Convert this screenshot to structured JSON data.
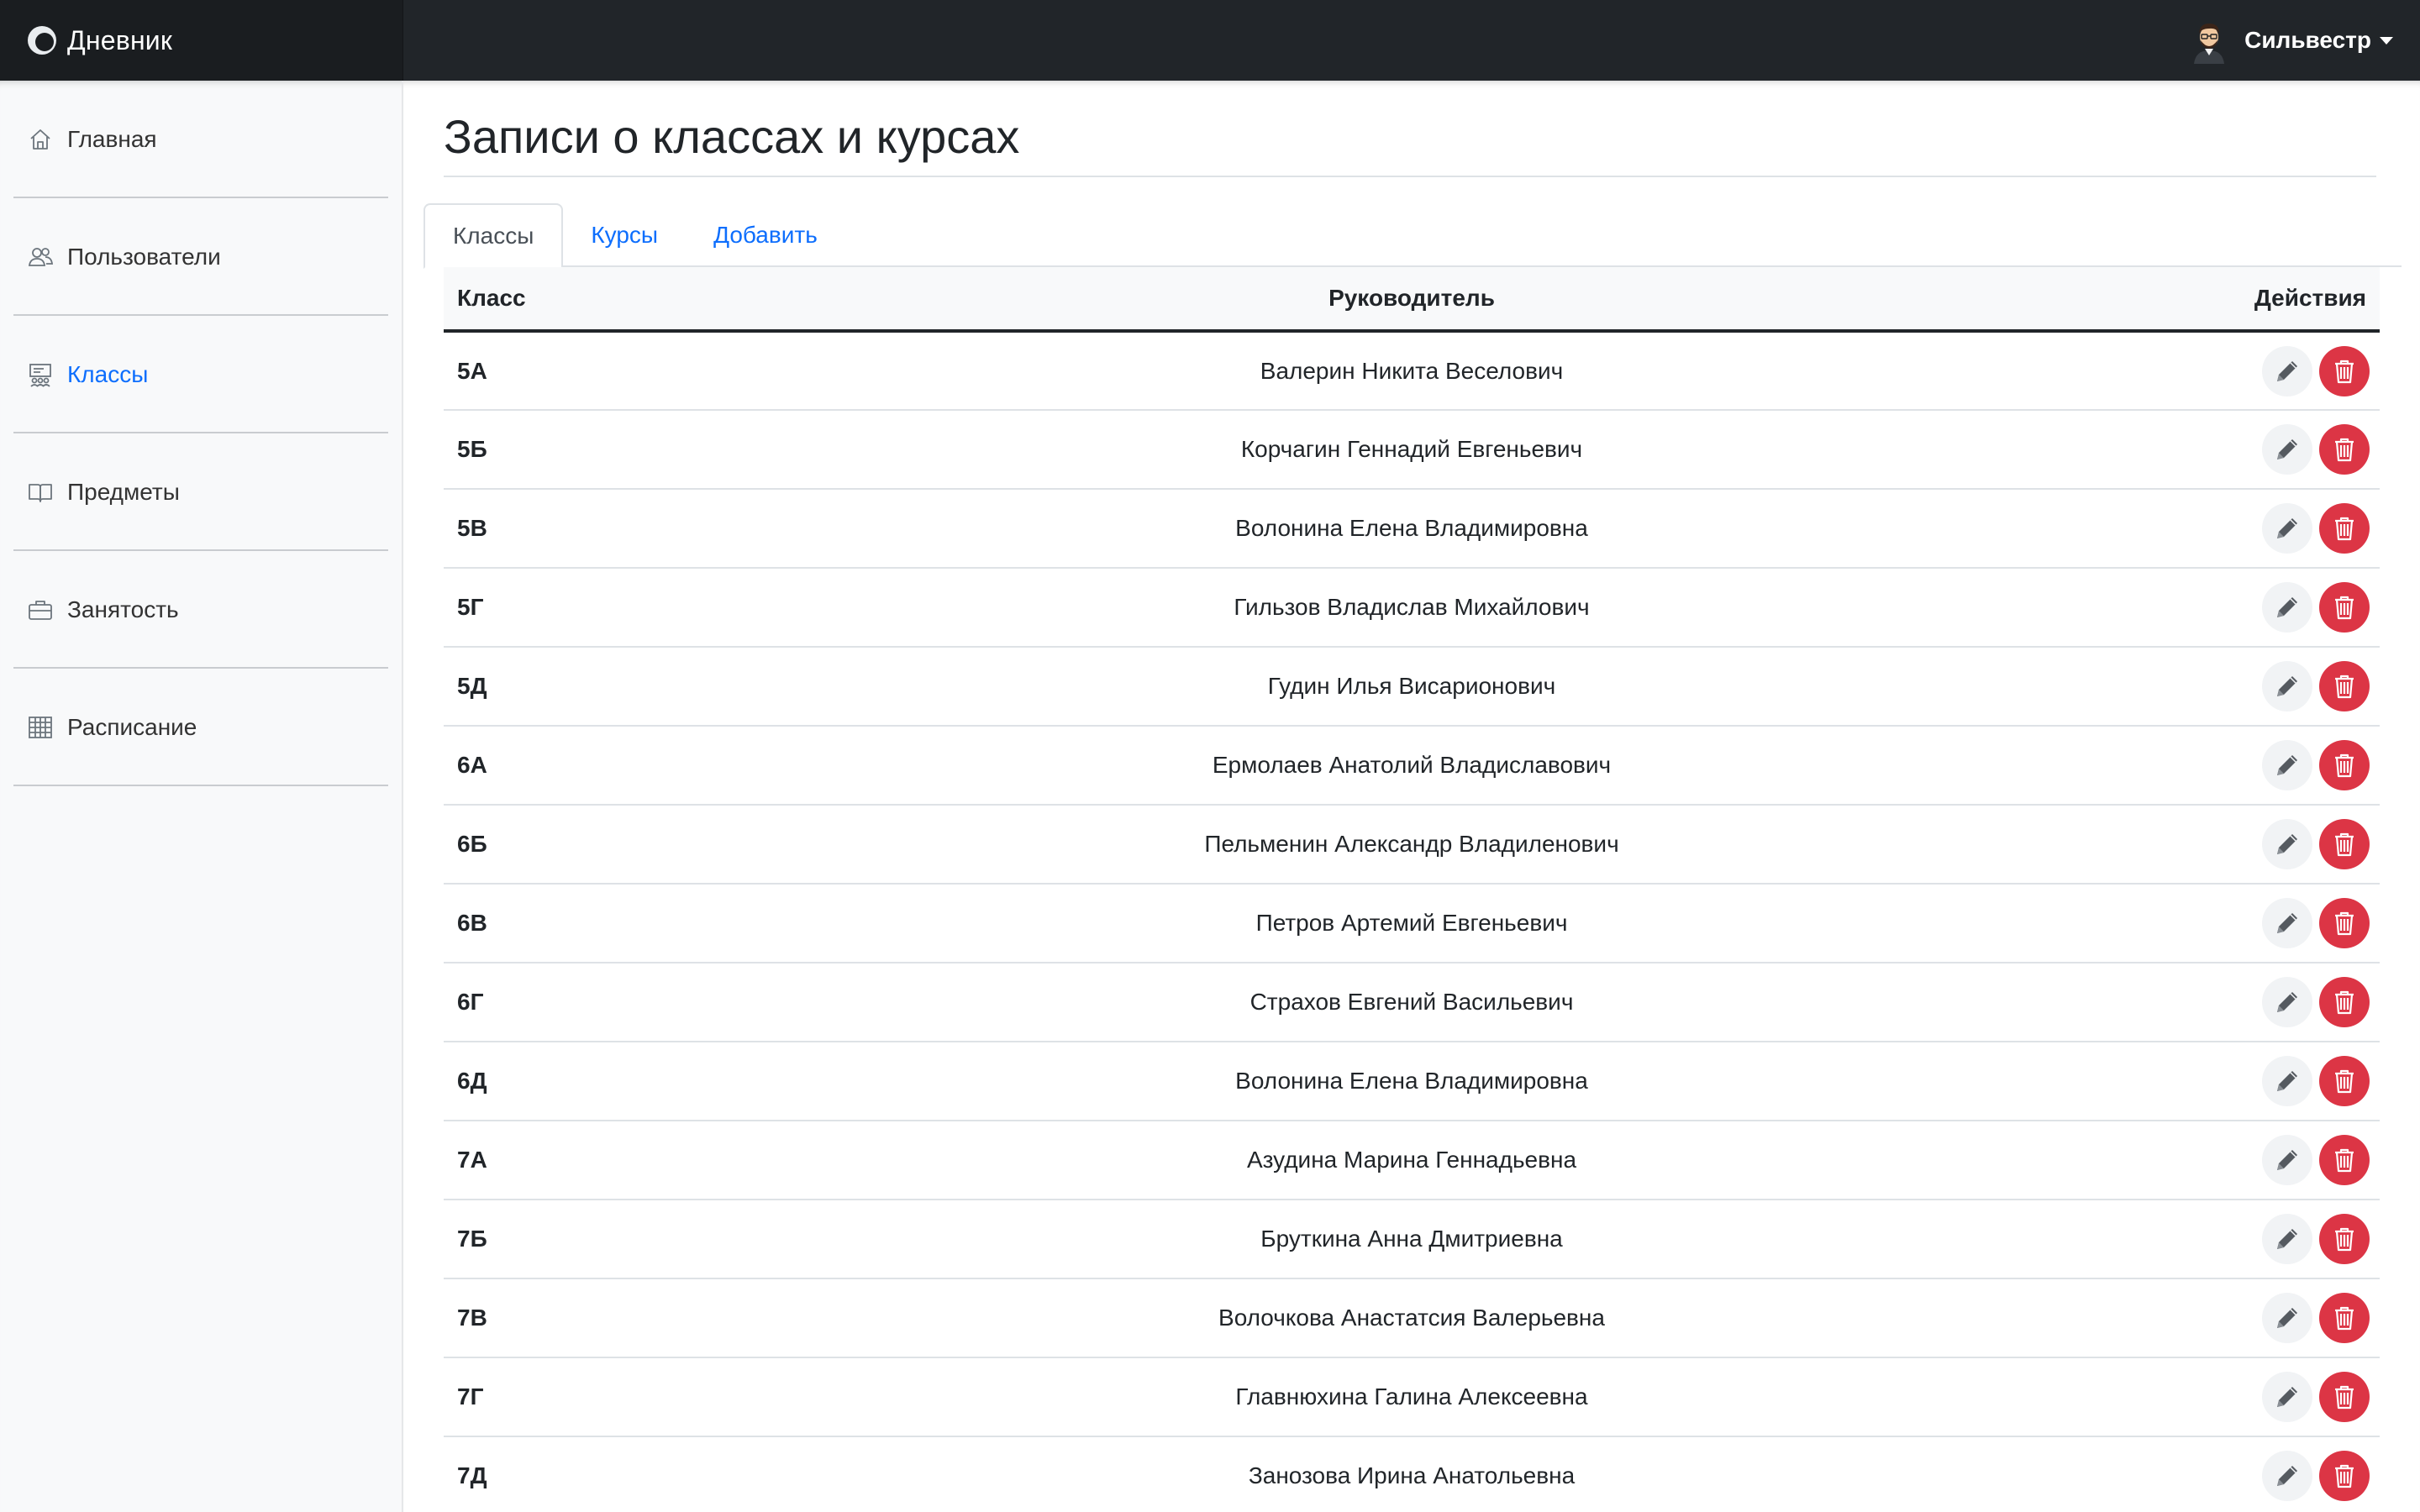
{
  "app": {
    "brand": "Дневник",
    "user_name": "Сильвестр"
  },
  "sidebar": {
    "items": [
      {
        "label": "Главная",
        "icon": "home-icon",
        "active": false
      },
      {
        "label": "Пользователи",
        "icon": "users-icon",
        "active": false
      },
      {
        "label": "Классы",
        "icon": "classroom-icon",
        "active": true
      },
      {
        "label": "Предметы",
        "icon": "book-icon",
        "active": false
      },
      {
        "label": "Занятость",
        "icon": "briefcase-icon",
        "active": false
      },
      {
        "label": "Расписание",
        "icon": "calendar-grid-icon",
        "active": false
      }
    ]
  },
  "main": {
    "title": "Записи о классах и курсах",
    "tabs": [
      {
        "label": "Классы",
        "active": true
      },
      {
        "label": "Курсы",
        "active": false
      },
      {
        "label": "Добавить",
        "active": false
      }
    ],
    "table": {
      "headers": {
        "class": "Класс",
        "head": "Руководитель",
        "actions": "Действия"
      },
      "rows": [
        {
          "class": "5А",
          "head": "Валерин Никита Веселович"
        },
        {
          "class": "5Б",
          "head": "Корчагин Геннадий Евгеньевич"
        },
        {
          "class": "5В",
          "head": "Волонина Елена Владимировна"
        },
        {
          "class": "5Г",
          "head": "Гильзов Владислав Михайлович"
        },
        {
          "class": "5Д",
          "head": "Гудин Илья Висарионович"
        },
        {
          "class": "6А",
          "head": "Ермолаев Анатолий Владиславович"
        },
        {
          "class": "6Б",
          "head": "Пельменин Александр Владиленович"
        },
        {
          "class": "6В",
          "head": "Петров Артемий Евгеньевич"
        },
        {
          "class": "6Г",
          "head": "Страхов Евгений Васильевич"
        },
        {
          "class": "6Д",
          "head": "Волонина Елена Владимировна"
        },
        {
          "class": "7А",
          "head": "Азудина Марина Геннадьевна"
        },
        {
          "class": "7Б",
          "head": "Бруткина Анна Дмитриевна"
        },
        {
          "class": "7В",
          "head": "Волочкова Анастатсия Валерьевна"
        },
        {
          "class": "7Г",
          "head": "Главнюхина Галина Алексеевна"
        },
        {
          "class": "7Д",
          "head": "Занозова Ирина Анатольевна"
        }
      ]
    }
  },
  "colors": {
    "navbar": "#212529",
    "accent": "#0d6efd",
    "danger": "#dc3545",
    "sidebar_bg": "#f8f9fa"
  }
}
